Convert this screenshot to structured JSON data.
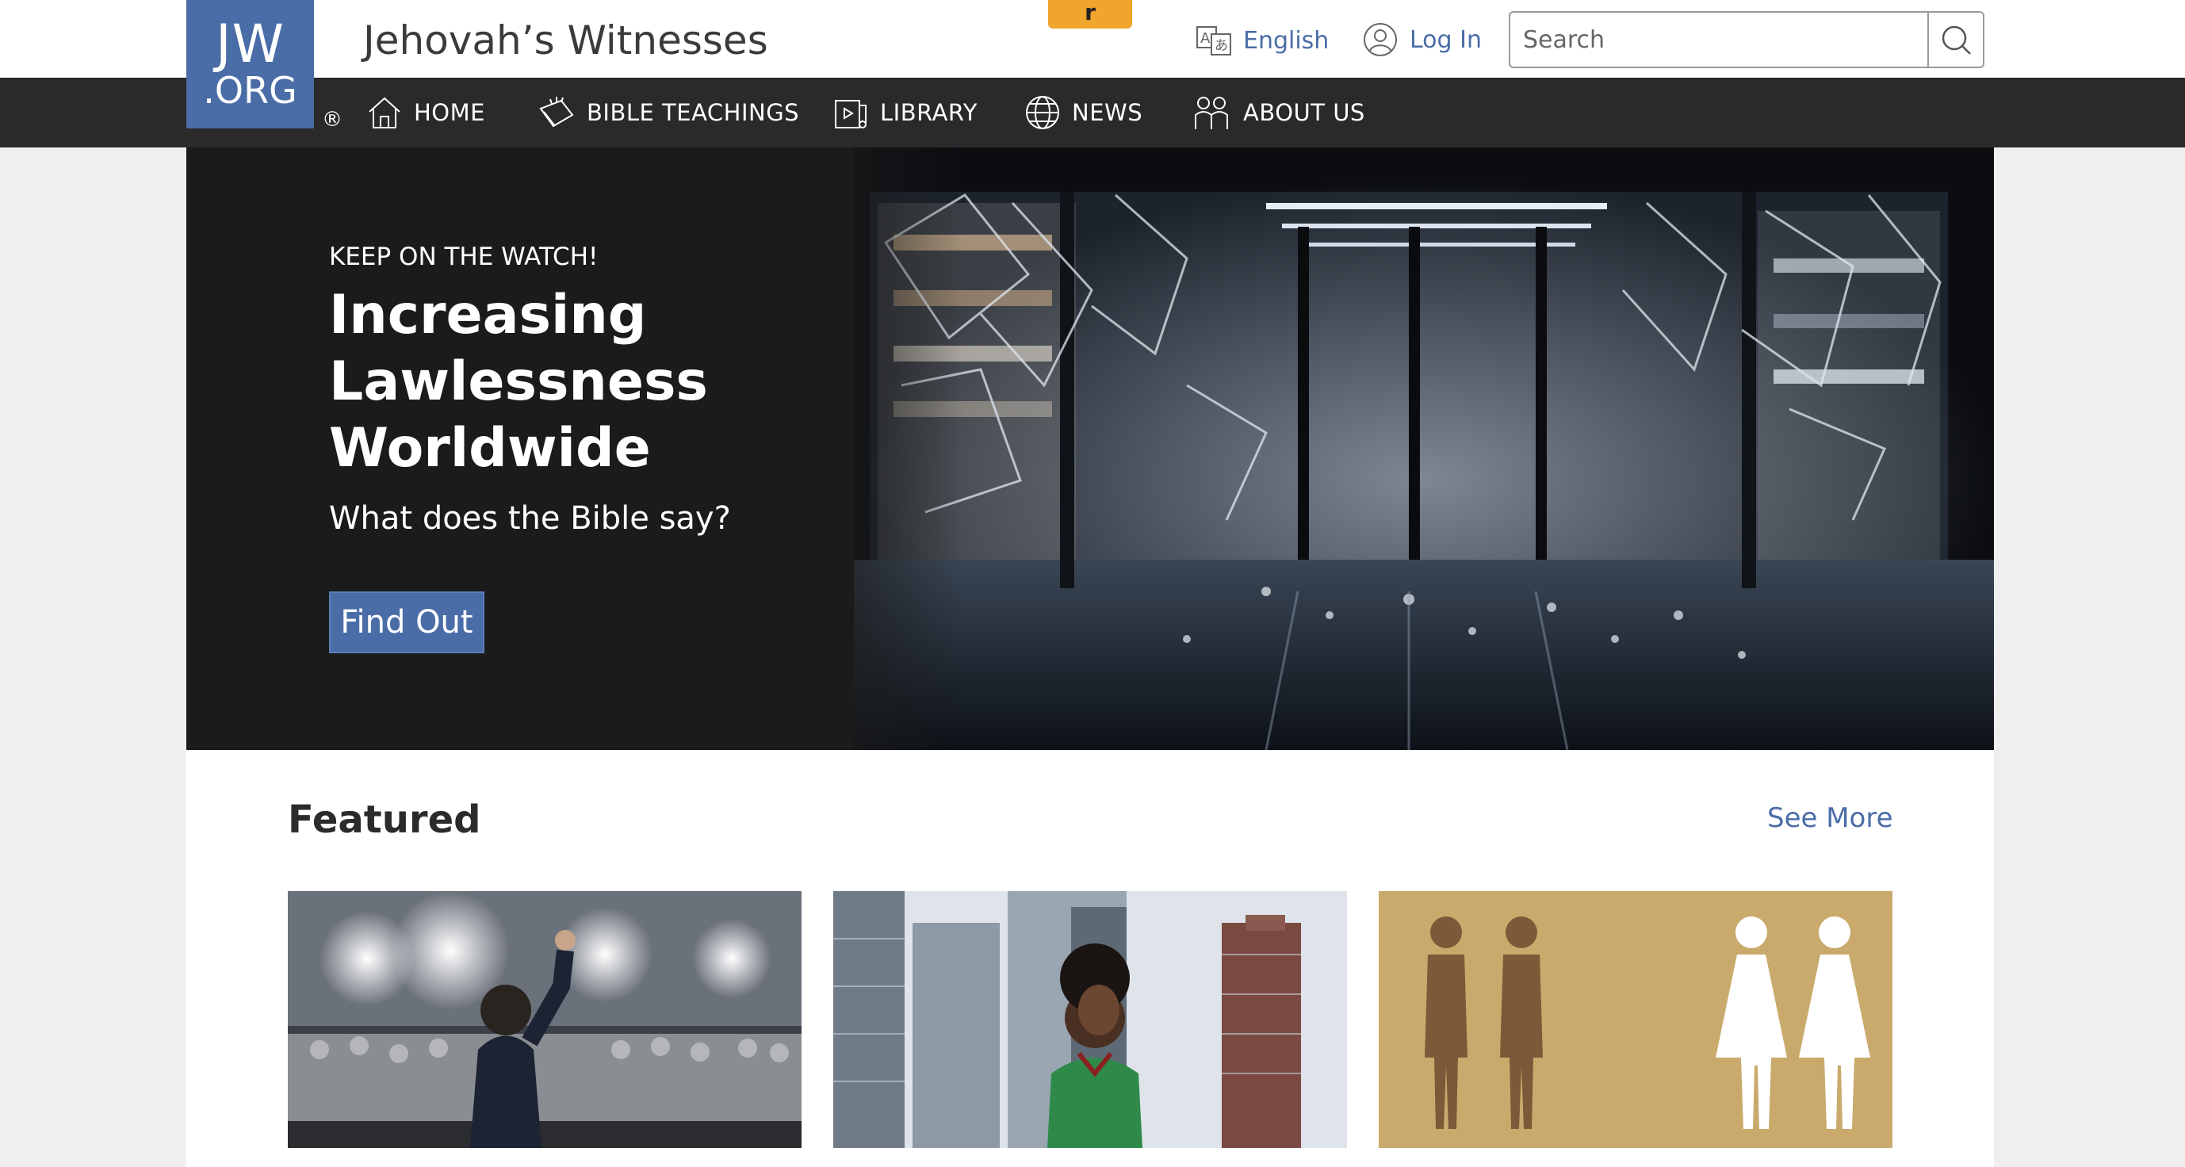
{
  "header": {
    "logo_line1": "JW",
    "logo_line2": ".ORG",
    "registered_mark": "®",
    "site_title": "Jehovah’s Witnesses",
    "tab_badge": "r",
    "language_label": "English",
    "login_label": "Log In",
    "search_placeholder": "Search"
  },
  "nav": {
    "items": [
      {
        "label": "HOME",
        "icon": "home-icon"
      },
      {
        "label": "BIBLE TEACHINGS",
        "icon": "open-book-icon"
      },
      {
        "label": "LIBRARY",
        "icon": "library-icon"
      },
      {
        "label": "NEWS",
        "icon": "globe-icon"
      },
      {
        "label": "ABOUT US",
        "icon": "people-icon"
      }
    ]
  },
  "hero": {
    "kicker": "KEEP ON THE WATCH!",
    "title": "Increasing Lawlessness Worldwide",
    "subtitle": "What does the Bible say?",
    "button_label": "Find Out"
  },
  "featured": {
    "heading": "Featured",
    "see_more": "See More"
  },
  "colors": {
    "brand_blue": "#4a6da7",
    "nav_bg": "#2a2a2a",
    "badge_orange": "#f0a52c"
  }
}
